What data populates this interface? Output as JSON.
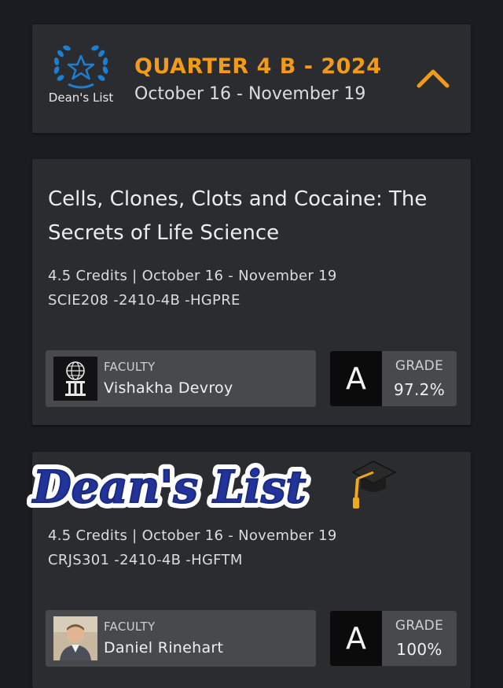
{
  "quarter": {
    "badge_text": "Dean's List",
    "title": "QUARTER 4 B - 2024",
    "dates": "October 16 - November 19",
    "colors": {
      "accent": "#f29a1a",
      "badge": "#1e7fd0"
    }
  },
  "courses": [
    {
      "title": "Cells, Clones, Clots and Cocaine: The Secrets of Life Science",
      "meta": "4.5 Credits | October 16 - November 19",
      "code": "SCIE208 -2410-4B -HGPRE",
      "faculty_label": "FACULTY",
      "faculty_name": "Vishakha Devroy",
      "grade_letter": "A",
      "grade_label": "GRADE",
      "grade_value": "97.2%"
    },
    {
      "meta": "4.5 Credits | October 16 - November 19",
      "code": "CRJS301 -2410-4B -HGFTM",
      "faculty_label": "FACULTY",
      "faculty_name": "Daniel Rinehart",
      "grade_letter": "A",
      "grade_label": "GRADE",
      "grade_value": "100%"
    }
  ],
  "sticker": {
    "text": "Dean's List"
  }
}
